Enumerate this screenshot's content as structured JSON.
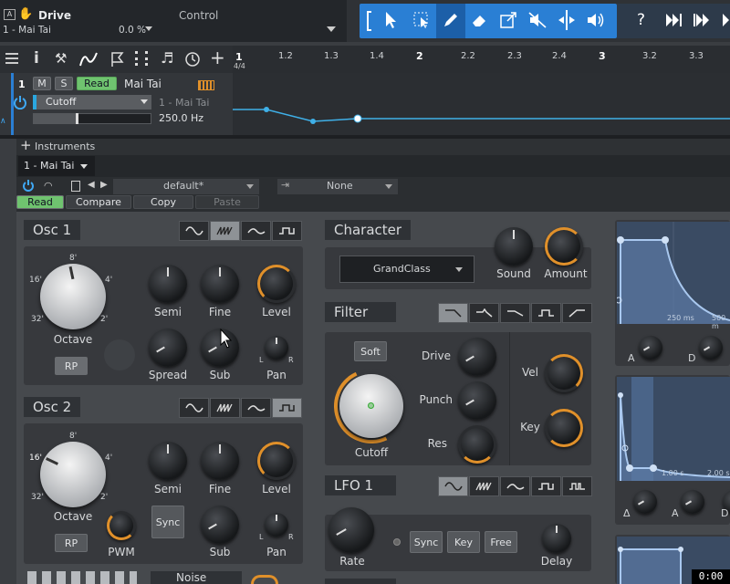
{
  "topbar": {
    "title": "Drive",
    "track": "1 - Mai Tai",
    "control_label": "Control",
    "control_value": "0.0 %",
    "icons": [
      "mono-icon",
      "hand-icon",
      "arrow-select-icon",
      "range-select-icon",
      "pencil-icon",
      "eraser-icon",
      "resize-icon",
      "mute-tool-icon",
      "split-tool-icon",
      "speaker-icon",
      "help-icon",
      "forward-icon",
      "skip-icon",
      "more-icon"
    ]
  },
  "ruler": {
    "ticks": [
      "1",
      "1.2",
      "1.3",
      "1.4",
      "2",
      "2.2",
      "2.3",
      "2.4",
      "3",
      "3.2",
      "3.3"
    ],
    "time_sig": "4/4"
  },
  "track": {
    "number": "1",
    "mute": "M",
    "solo": "S",
    "read": "Read",
    "name": "Mai Tai",
    "param": "Cutoff",
    "param_source": "1 - Mai Tai",
    "value": "250.0 Hz"
  },
  "instruments": {
    "title": "Instruments",
    "track": "1 - Mai Tai",
    "preset": "default*",
    "none_label": "None",
    "read": "Read",
    "compare": "Compare",
    "copy": "Copy",
    "paste": "Paste"
  },
  "osc1": {
    "title": "Osc 1",
    "octave": "Octave",
    "marks": [
      "8'",
      "4'",
      "2'",
      "32'",
      "16'"
    ],
    "semi": "Semi",
    "fine": "Fine",
    "level": "Level",
    "spread": "Spread",
    "sub": "Sub",
    "pan": "Pan",
    "rp": "RP",
    "l": "L",
    "r": "R"
  },
  "osc2": {
    "title": "Osc 2",
    "octave": "Octave",
    "marks": [
      "8'",
      "4'",
      "2'",
      "32'",
      "16'"
    ],
    "semi": "Semi",
    "fine": "Fine",
    "level": "Level",
    "pwm": "PWM",
    "sync": "Sync",
    "sub": "Sub",
    "pan": "Pan",
    "rp": "RP",
    "l": "L",
    "r": "R"
  },
  "character": {
    "title": "Character",
    "preset": "GrandClass",
    "sound": "Sound",
    "amount": "Amount"
  },
  "filter": {
    "title": "Filter",
    "soft": "Soft",
    "cutoff": "Cutoff",
    "drive": "Drive",
    "punch": "Punch",
    "res": "Res",
    "vel": "Vel",
    "key": "Key"
  },
  "lfo1": {
    "title": "LFO 1",
    "rate": "Rate",
    "sync": "Sync",
    "key": "Key",
    "free": "Free",
    "delay": "Delay"
  },
  "noise": {
    "title": "Noise"
  },
  "env1": {
    "t1": "250 ms",
    "t2": "500 m",
    "a": "A",
    "d": "D"
  },
  "env2": {
    "t1": "1.00 s",
    "t2": "2.00 s",
    "delta": "Δ",
    "a": "A",
    "d": "D"
  },
  "status": {
    "time": "0:00"
  },
  "colors": {
    "accent": "#2a7fd4",
    "orange": "#e0902a",
    "read_green": "#6fc36f",
    "lane_line": "#3fb0e8"
  }
}
